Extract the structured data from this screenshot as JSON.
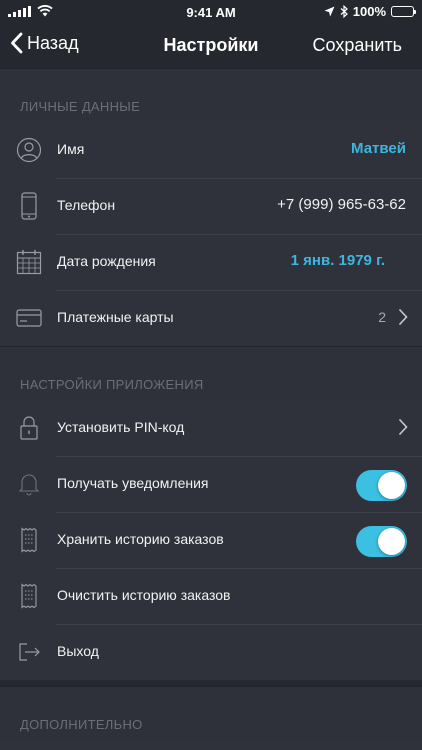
{
  "status_bar": {
    "time": "9:41 AM",
    "battery": "100%",
    "icons": [
      "signal-icon",
      "wifi-icon",
      "location-icon",
      "bluetooth-icon",
      "battery-icon"
    ]
  },
  "nav": {
    "back_label": "Назад",
    "title": "Настройки",
    "save_label": "Сохранить"
  },
  "colors": {
    "accent": "#3db6de",
    "toggle_on": "#3bbfe3",
    "background": "#262830",
    "row_background": "#30323b"
  },
  "sections": {
    "personal": {
      "header": "ЛИЧНЫЕ ДАННЫЕ",
      "items": [
        {
          "icon": "user-icon",
          "label": "Имя",
          "value": "Матвей"
        },
        {
          "icon": "phone-icon",
          "label": "Телефон",
          "value": "+7 (999) 965-63-62"
        },
        {
          "icon": "calendar-icon",
          "label": "Дата рождения",
          "value": "1 янв. 1979 г."
        },
        {
          "icon": "card-icon",
          "label": "Платежные карты",
          "value": "2"
        }
      ]
    },
    "app": {
      "header": "НАСТРОЙКИ ПРИЛОЖЕНИЯ",
      "items": [
        {
          "icon": "lock-icon",
          "label": "Установить PIN-код"
        },
        {
          "icon": "bell-icon",
          "label": "Получать уведомления",
          "toggle": true
        },
        {
          "icon": "receipt-icon",
          "label": "Хранить историю заказов",
          "toggle": true
        },
        {
          "icon": "receipt-icon",
          "label": "Очистить историю заказов"
        },
        {
          "icon": "logout-icon",
          "label": "Выход"
        }
      ]
    },
    "extra": {
      "header": "ДОПОЛНИТЕЛЬНО"
    }
  }
}
